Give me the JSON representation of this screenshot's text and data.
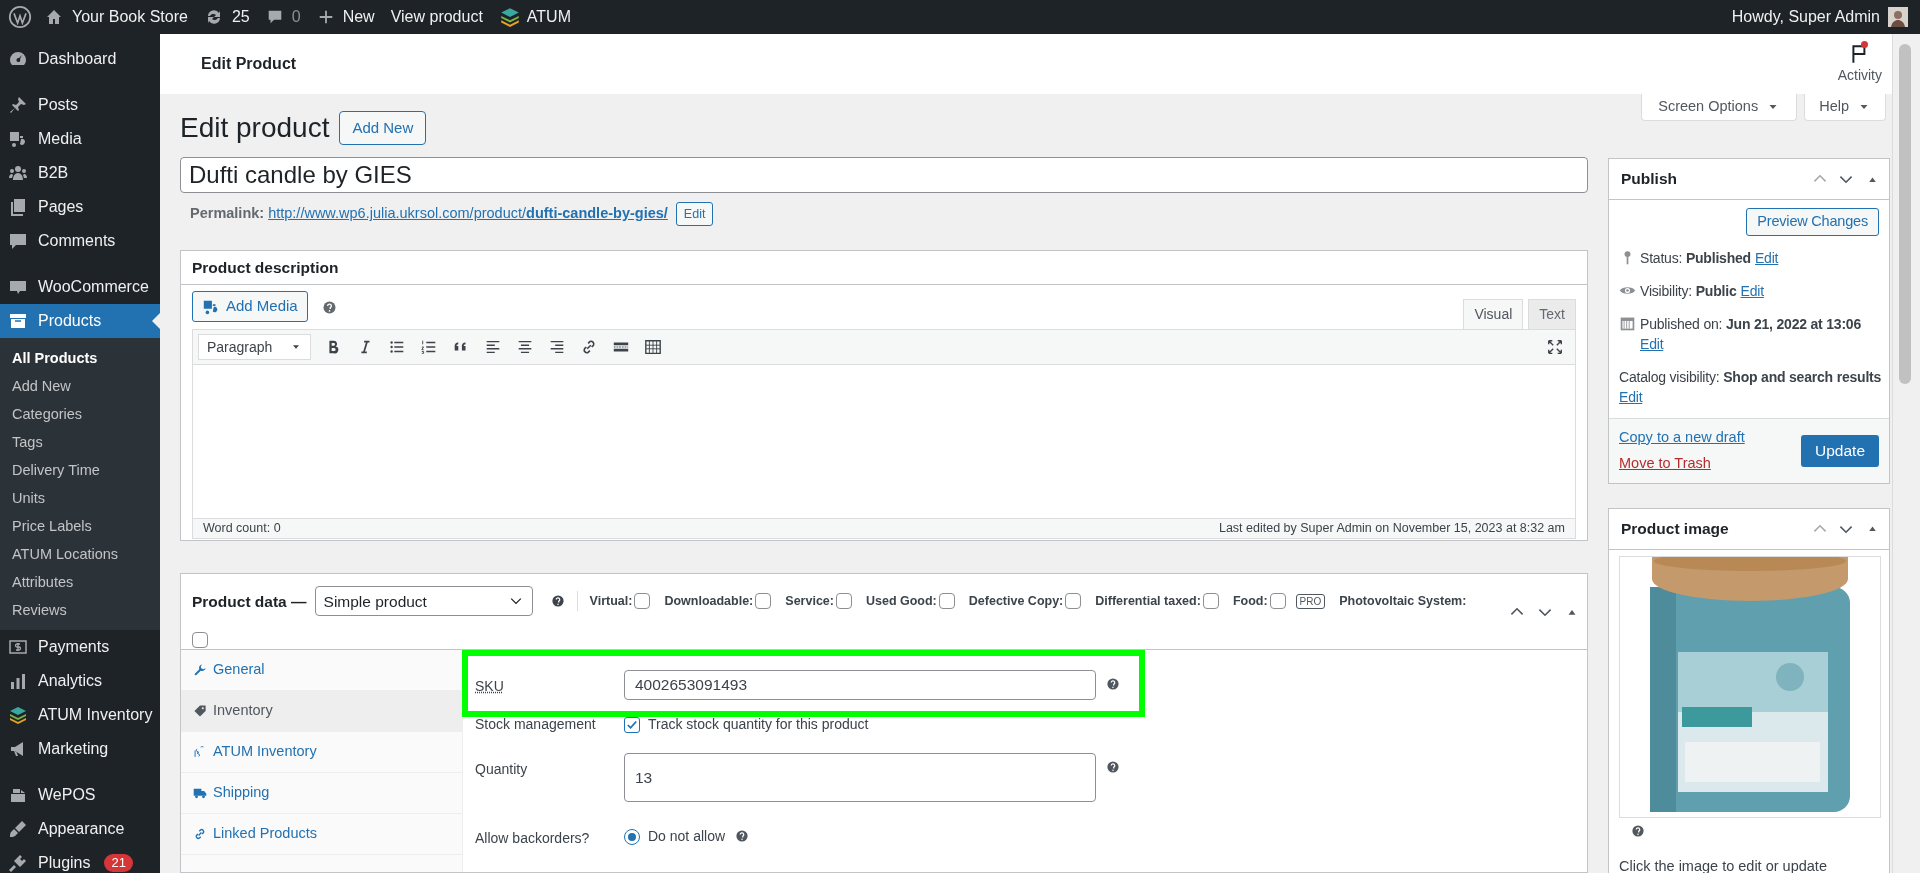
{
  "admin_bar": {
    "site": "Your Book Store",
    "updates": "25",
    "comments": "0",
    "new": "New",
    "view": "View product",
    "atum": "ATUM",
    "greeting": "Howdy, Super Admin"
  },
  "sidebar": {
    "items": [
      {
        "label": "Dashboard",
        "selected": false
      },
      {
        "label": "Posts",
        "selected": false
      },
      {
        "label": "Media",
        "selected": false
      },
      {
        "label": "B2B",
        "selected": false
      },
      {
        "label": "Pages",
        "selected": false
      },
      {
        "label": "Comments",
        "selected": false
      },
      {
        "label": "WooCommerce",
        "selected": false
      },
      {
        "label": "Products",
        "selected": true,
        "children": [
          {
            "label": "All Products",
            "selected": true
          },
          {
            "label": "Add New",
            "selected": false
          },
          {
            "label": "Categories",
            "selected": false
          },
          {
            "label": "Tags",
            "selected": false
          },
          {
            "label": "Delivery Time",
            "selected": false
          },
          {
            "label": "Units",
            "selected": false
          },
          {
            "label": "Price Labels",
            "selected": false
          },
          {
            "label": "ATUM Locations",
            "selected": false
          },
          {
            "label": "Attributes",
            "selected": false
          },
          {
            "label": "Reviews",
            "selected": false
          }
        ]
      },
      {
        "label": "Payments",
        "selected": false
      },
      {
        "label": "Analytics",
        "selected": false
      },
      {
        "label": "ATUM Inventory",
        "selected": false
      },
      {
        "label": "Marketing",
        "selected": false
      },
      {
        "label": "WePOS",
        "selected": false
      },
      {
        "label": "Appearance",
        "selected": false
      },
      {
        "label": "Plugins",
        "selected": false,
        "badge": "21"
      }
    ]
  },
  "header": {
    "title": "Edit Product",
    "activity": "Activity",
    "activity_alert": true
  },
  "screen_options": "Screen Options",
  "help": "Help",
  "page": {
    "heading": "Edit product",
    "add_new": "Add New",
    "title_value": "Dufti candle by GIES",
    "permalink_label": "Permalink:",
    "permalink": "http://www.wp6.julia.ukrsol.com/product/**dufti-candle-by-gies/**",
    "permalink_edit": "Edit"
  },
  "description": {
    "title": "Product description",
    "add_media": "Add Media",
    "tabs": [
      {
        "label": "Visual",
        "selected": true
      },
      {
        "label": "Text",
        "selected": false
      }
    ],
    "format": "Paragraph",
    "word_count": "Word count: 0",
    "last_edited": "Last edited by Super Admin on November 15, 2023 at 8:32 am"
  },
  "product_data": {
    "title": "Product data —",
    "type": "Simple product",
    "options": [
      {
        "label": "Virtual:",
        "checked": false
      },
      {
        "label": "Downloadable:",
        "checked": false
      },
      {
        "label": "Service:",
        "checked": false
      },
      {
        "label": "Used Good:",
        "checked": false
      },
      {
        "label": "Defective Copy:",
        "checked": false
      },
      {
        "label": "Differential taxed:",
        "checked": false
      },
      {
        "label": "Food:",
        "checked": false,
        "badge": "PRO"
      },
      {
        "label": "Photovoltaic System:",
        "checked": false
      }
    ],
    "tabs": [
      {
        "label": "General",
        "selected": false
      },
      {
        "label": "Inventory",
        "selected": true
      },
      {
        "label": "ATUM Inventory",
        "selected": false
      },
      {
        "label": "Shipping",
        "selected": false
      },
      {
        "label": "Linked Products",
        "selected": false
      }
    ],
    "fields": [
      {
        "kind": "text",
        "label": "SKU",
        "value": "4002653091493",
        "highlighted": true
      },
      {
        "kind": "checkbox",
        "label": "Stock management",
        "text": "Track stock quantity for this product",
        "checked": true,
        "highlighted": false
      },
      {
        "kind": "number",
        "label": "Quantity",
        "value": "13",
        "highlighted": false
      },
      {
        "kind": "radio",
        "label": "Allow backorders?",
        "options": [
          {
            "label": "Do not allow",
            "selected": true
          }
        ],
        "highlighted": false
      }
    ]
  },
  "publish": {
    "title": "Publish",
    "preview": "Preview Changes",
    "rows": [
      {
        "label": "Status:",
        "value": "Published",
        "edit": "Edit"
      },
      {
        "label": "Visibility:",
        "value": "Public",
        "edit": "Edit"
      },
      {
        "label": "Published on:",
        "value": "Jun 21, 2022 at 13:06",
        "edit": "Edit"
      },
      {
        "label": "Catalog visibility:",
        "value": "Shop and search results",
        "edit": "Edit"
      }
    ],
    "copy": "Copy to a new draft",
    "trash": "Move to Trash",
    "update": "Update"
  },
  "product_image": {
    "title": "Product image",
    "hint": "Click the image to edit or update"
  }
}
